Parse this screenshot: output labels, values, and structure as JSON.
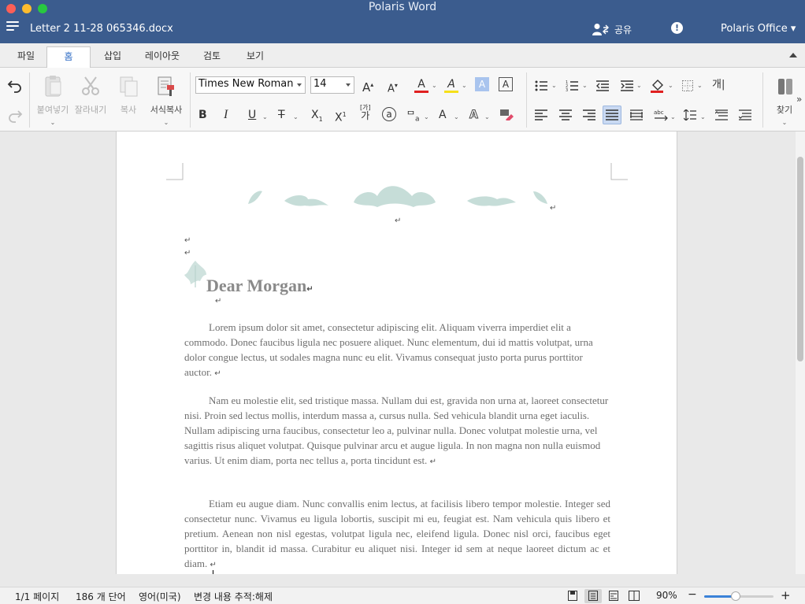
{
  "window": {
    "app_title": "Polaris Word",
    "doc_name": "Letter 2 11-28 065346.docx",
    "share_label": "공유",
    "alert_label": "!",
    "account_label": "Polaris Office ▾"
  },
  "tabs": [
    {
      "label": "파일"
    },
    {
      "label": "홈",
      "active": true
    },
    {
      "label": "삽입"
    },
    {
      "label": "레이아웃"
    },
    {
      "label": "검토"
    },
    {
      "label": "보기"
    }
  ],
  "ribbon": {
    "paste_label": "붙여넣기",
    "cut_label": "잘라내기",
    "copy_label": "복사",
    "format_painter_label": "서식복사",
    "font_name": "Times New Roman",
    "font_size": "14",
    "find_label": "찾기",
    "text_a": "A",
    "bold": "B",
    "italic": "I",
    "underline": "U",
    "strike": "T",
    "subscript": "X",
    "superscript": "X",
    "phonetic_top": "[가]",
    "phonetic_bottom": "가",
    "enclose": "a",
    "char_spacing": "a",
    "bullet_label": "개"
  },
  "colors": {
    "accent": "#3b5c8e",
    "font_color": "#e02020",
    "highlight": "#f6e01a"
  },
  "document": {
    "salutation": "Dear Morgan",
    "paragraphs": [
      "Lorem ipsum dolor sit amet, consectetur adipiscing elit. Aliquam viverra imperdiet elit a commodo. Donec faucibus ligula nec posuere aliquet. Nunc elementum, dui id mattis volutpat, urna dolor congue lectus, ut sodales magna nunc eu elit. Vivamus consequat justo porta purus porttitor auctor.",
      "Nam eu molestie elit, sed tristique massa. Nullam dui est, gravida non urna at, laoreet consectetur nisi. Proin sed lectus mollis, interdum massa a, cursus nulla. Sed vehicula blandit urna eget iaculis. Nullam adipiscing urna faucibus, consectetur leo a, pulvinar nulla. Donec volutpat molestie urna, vel sagittis risus aliquet volutpat. Quisque pulvinar arcu et augue ligula. In non magna non nulla euismod varius. Ut enim diam, porta nec tellus a, porta tincidunt est.",
      "Etiam eu augue diam. Nunc convallis enim lectus, at facilisis libero tempor molestie. Integer sed consectetur nunc. Vivamus eu ligula lobortis, suscipit mi eu, feugiat est. Nam vehicula quis libero et pretium. Aenean non nisl egestas, volutpat ligula nec, eleifend ligula. Donec nisl orci, faucibus eget porttitor in, blandit id massa. Curabitur eu aliquet nisi. Integer id sem at neque laoreet dictum ac et diam."
    ],
    "paragraph_mark": "↵"
  },
  "status": {
    "page": "1/1 페이지",
    "words": "186 개 단어",
    "language": "영어(미국)",
    "track_changes": "변경 내용 추적:해제",
    "zoom": "90%",
    "zoom_minus": "−",
    "zoom_plus": "+",
    "zoom_fraction": 0.45
  }
}
